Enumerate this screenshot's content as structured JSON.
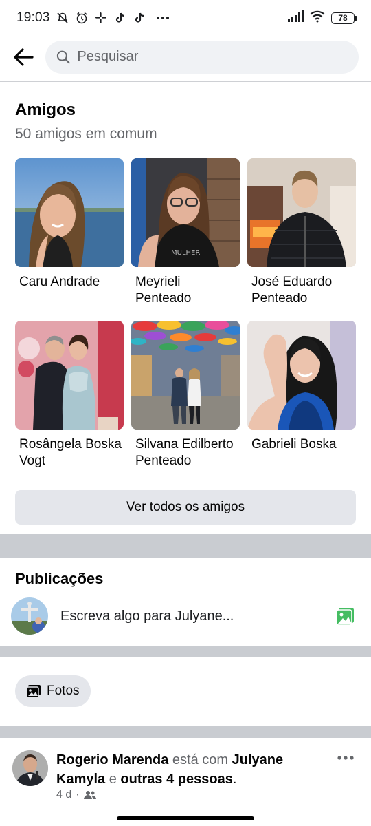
{
  "status_bar": {
    "time": "19:03",
    "battery": "78",
    "icons": [
      "muted-icon",
      "alarm-icon",
      "slack-icon",
      "tiktok-icon",
      "tiktok-icon",
      "more-dots-icon",
      "signal-icon",
      "wifi-icon",
      "battery-icon"
    ]
  },
  "header": {
    "search_placeholder": "Pesquisar"
  },
  "friends": {
    "title": "Amigos",
    "subtitle": "50 amigos em comum",
    "items": [
      {
        "name": "Caru Andrade"
      },
      {
        "name": "Meyrieli Penteado"
      },
      {
        "name": "José Eduardo Penteado"
      },
      {
        "name": "Rosângela Boska Vogt"
      },
      {
        "name": "Silvana Edilberto Penteado"
      },
      {
        "name": "Gabrieli Boska"
      }
    ],
    "see_all_label": "Ver todos os amigos"
  },
  "posts": {
    "title": "Publicações",
    "composer_placeholder": "Escreva algo para Julyane..."
  },
  "chips": {
    "photos_label": "Fotos"
  },
  "feed_post": {
    "author": "Rogerio Marenda",
    "connector": "está com",
    "tagged": "Julyane Kamyla",
    "and_word": "e",
    "others": "outras 4 pessoas",
    "end": ".",
    "time": "4 d",
    "audience_icon": "friends-icon"
  },
  "colors": {
    "accent_green": "#45bd62",
    "divider": "#c9ccd1",
    "muted_text": "#65676b",
    "chip_bg": "#e4e6eb"
  }
}
